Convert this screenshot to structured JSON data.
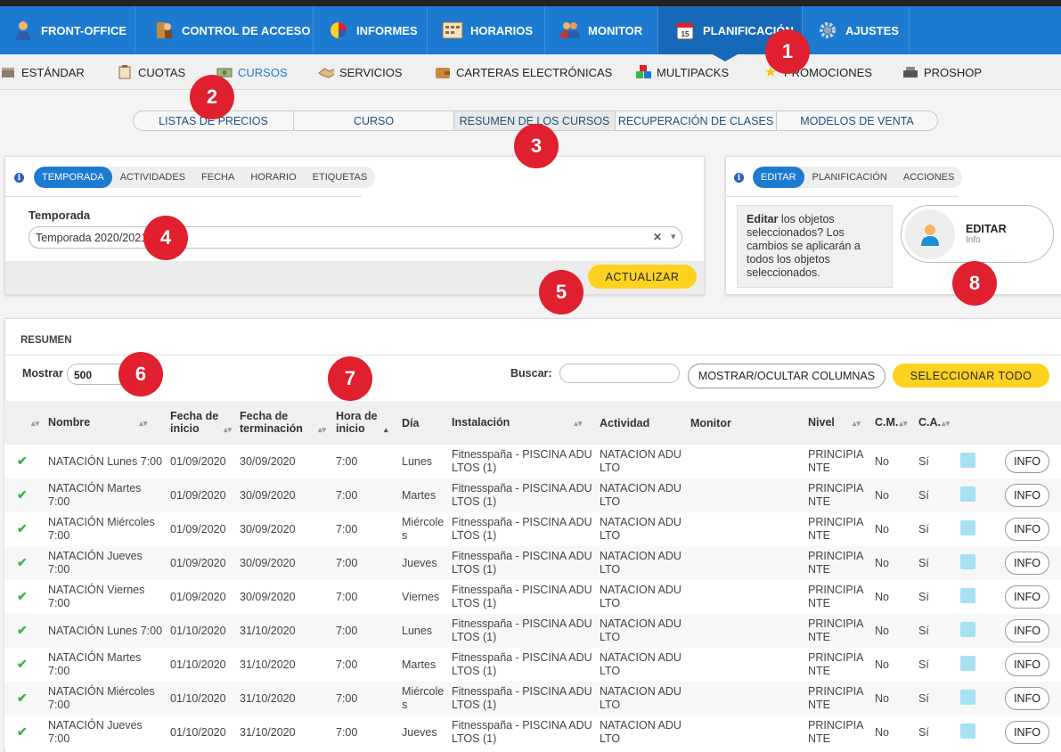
{
  "colors": {
    "brand_blue": "#1c7ad1",
    "accent_yellow": "#ffd21f",
    "badge_red": "#e0202e",
    "check_green": "#3ab54a",
    "swatch_cyan": "#a7e0f2"
  },
  "main_nav": [
    {
      "label": "FRONT-OFFICE",
      "icon": "person-icon"
    },
    {
      "label": "CONTROL DE ACCESO",
      "icon": "access-control-icon"
    },
    {
      "label": "INFORMES",
      "icon": "pie-chart-icon"
    },
    {
      "label": "HORARIOS",
      "icon": "calendar-grid-icon"
    },
    {
      "label": "MONITOR",
      "icon": "people-icon"
    },
    {
      "label": "PLANIFICACIÓN",
      "icon": "calendar-icon",
      "active": true
    },
    {
      "label": "AJUSTES",
      "icon": "gear-icon"
    }
  ],
  "sub_nav": [
    {
      "label": "ESTÁNDAR",
      "icon": "box-icon"
    },
    {
      "label": "CUOTAS",
      "icon": "clipboard-icon"
    },
    {
      "label": "CURSOS",
      "icon": "money-icon",
      "active": true
    },
    {
      "label": "SERVICIOS",
      "icon": "handshake-icon"
    },
    {
      "label": "CARTERAS ELECTRÓNICAS",
      "icon": "wallet-icon"
    },
    {
      "label": "MULTIPACKS",
      "icon": "cubes-icon"
    },
    {
      "label": "PROMOCIONES",
      "icon": "star-icon"
    },
    {
      "label": "PROSHOP",
      "icon": "cash-register-icon"
    }
  ],
  "section_tabs": [
    {
      "label": "LISTAS DE PRECIOS"
    },
    {
      "label": "CURSO"
    },
    {
      "label": "RESUMEN DE LOS CURSOS",
      "active": true
    },
    {
      "label": "RECUPERACIÓN DE CLASES"
    },
    {
      "label": "MODELOS DE VENTA"
    }
  ],
  "filter_panel": {
    "tabs": [
      {
        "label": "TEMPORADA",
        "active": true
      },
      {
        "label": "ACTIVIDADES"
      },
      {
        "label": "FECHA"
      },
      {
        "label": "HORARIO"
      },
      {
        "label": "ETIQUETAS"
      }
    ],
    "field_label": "Temporada",
    "field_value": "Temporada 2020/2021",
    "clear_glyph": "✕",
    "dropdown_glyph": "▾",
    "update_button": "ACTUALIZAR"
  },
  "edit_panel": {
    "tabs": [
      {
        "label": "EDITAR",
        "active": true
      },
      {
        "label": "PLANIFICACIÓN"
      },
      {
        "label": "ACCIONES"
      }
    ],
    "description_bold": "Editar",
    "description_rest": " los objetos seleccionados? Los cambios se aplicarán a todos los objetos seleccionados.",
    "edit_card_title": "EDITAR",
    "edit_card_subtitle": "Info"
  },
  "summary": {
    "tab_label": "RESUMEN",
    "show_label": "Mostrar",
    "show_value": "500",
    "search_label": "Buscar:",
    "search_value": "",
    "toggle_columns_button": "MOSTRAR/OCULTAR COLUMNAS",
    "select_all_button": "SELECCIONAR TODO"
  },
  "table": {
    "columns": [
      {
        "label": "",
        "sortable": true
      },
      {
        "label": "Nombre",
        "sortable": true
      },
      {
        "label": "Fecha de inicio",
        "sortable": true
      },
      {
        "label": "Fecha de terminación",
        "sortable": true
      },
      {
        "label": "Hora de inicio",
        "sortable": true,
        "sorted": "asc"
      },
      {
        "label": "Día",
        "sortable": false
      },
      {
        "label": "Instalación",
        "sortable": true
      },
      {
        "label": "Actividad",
        "sortable": false
      },
      {
        "label": "Monitor",
        "sortable": false
      },
      {
        "label": "Nivel",
        "sortable": true
      },
      {
        "label": "C.M.",
        "sortable": true
      },
      {
        "label": "C.A.",
        "sortable": true
      },
      {
        "label": "",
        "sortable": false
      },
      {
        "label": "",
        "sortable": false
      }
    ],
    "info_label": "INFO",
    "rows": [
      {
        "name": "NATACIÓN Lunes 7:00",
        "start": "01/09/2020",
        "end": "30/09/2020",
        "time": "7:00",
        "day": "Lunes",
        "facility": "Fitnesspaña - PISCINA ADULTOS (1)",
        "activity": "NATACION ADULTO",
        "monitor": "",
        "level": "PRINCIPIANTE",
        "cm": "No",
        "ca": "Sí"
      },
      {
        "name": "NATACIÓN Martes 7:00",
        "start": "01/09/2020",
        "end": "30/09/2020",
        "time": "7:00",
        "day": "Martes",
        "facility": "Fitnesspaña - PISCINA ADULTOS (1)",
        "activity": "NATACION ADULTO",
        "monitor": "",
        "level": "PRINCIPIANTE",
        "cm": "No",
        "ca": "Sí"
      },
      {
        "name": "NATACIÓN Miércoles 7:00",
        "start": "01/09/2020",
        "end": "30/09/2020",
        "time": "7:00",
        "day": "Miércoles",
        "facility": "Fitnesspaña - PISCINA ADULTOS (1)",
        "activity": "NATACION ADULTO",
        "monitor": "",
        "level": "PRINCIPIANTE",
        "cm": "No",
        "ca": "Sí"
      },
      {
        "name": "NATACIÓN Jueves 7:00",
        "start": "01/09/2020",
        "end": "30/09/2020",
        "time": "7:00",
        "day": "Jueves",
        "facility": "Fitnesspaña - PISCINA ADULTOS (1)",
        "activity": "NATACION ADULTO",
        "monitor": "",
        "level": "PRINCIPIANTE",
        "cm": "No",
        "ca": "Sí"
      },
      {
        "name": "NATACIÓN Viernes 7:00",
        "start": "01/09/2020",
        "end": "30/09/2020",
        "time": "7:00",
        "day": "Viernes",
        "facility": "Fitnesspaña - PISCINA ADULTOS (1)",
        "activity": "NATACION ADULTO",
        "monitor": "",
        "level": "PRINCIPIANTE",
        "cm": "No",
        "ca": "Sí"
      },
      {
        "name": "NATACIÓN Lunes 7:00",
        "start": "01/10/2020",
        "end": "31/10/2020",
        "time": "7:00",
        "day": "Lunes",
        "facility": "Fitnesspaña - PISCINA ADULTOS (1)",
        "activity": "NATACION ADULTO",
        "monitor": "",
        "level": "PRINCIPIANTE",
        "cm": "No",
        "ca": "Sí"
      },
      {
        "name": "NATACIÓN Martes 7:00",
        "start": "01/10/2020",
        "end": "31/10/2020",
        "time": "7:00",
        "day": "Martes",
        "facility": "Fitnesspaña - PISCINA ADULTOS (1)",
        "activity": "NATACION ADULTO",
        "monitor": "",
        "level": "PRINCIPIANTE",
        "cm": "No",
        "ca": "Sí"
      },
      {
        "name": "NATACIÓN Miércoles 7:00",
        "start": "01/10/2020",
        "end": "31/10/2020",
        "time": "7:00",
        "day": "Miércoles",
        "facility": "Fitnesspaña - PISCINA ADULTOS (1)",
        "activity": "NATACION ADULTO",
        "monitor": "",
        "level": "PRINCIPIANTE",
        "cm": "No",
        "ca": "Sí"
      },
      {
        "name": "NATACIÓN Jueves 7:00",
        "start": "01/10/2020",
        "end": "31/10/2020",
        "time": "7:00",
        "day": "Jueves",
        "facility": "Fitnesspaña - PISCINA ADULTOS (1)",
        "activity": "NATACION ADULTO",
        "monitor": "",
        "level": "PRINCIPIANTE",
        "cm": "No",
        "ca": "Sí"
      }
    ]
  },
  "badges": [
    "1",
    "2",
    "3",
    "4",
    "5",
    "6",
    "7",
    "8"
  ]
}
